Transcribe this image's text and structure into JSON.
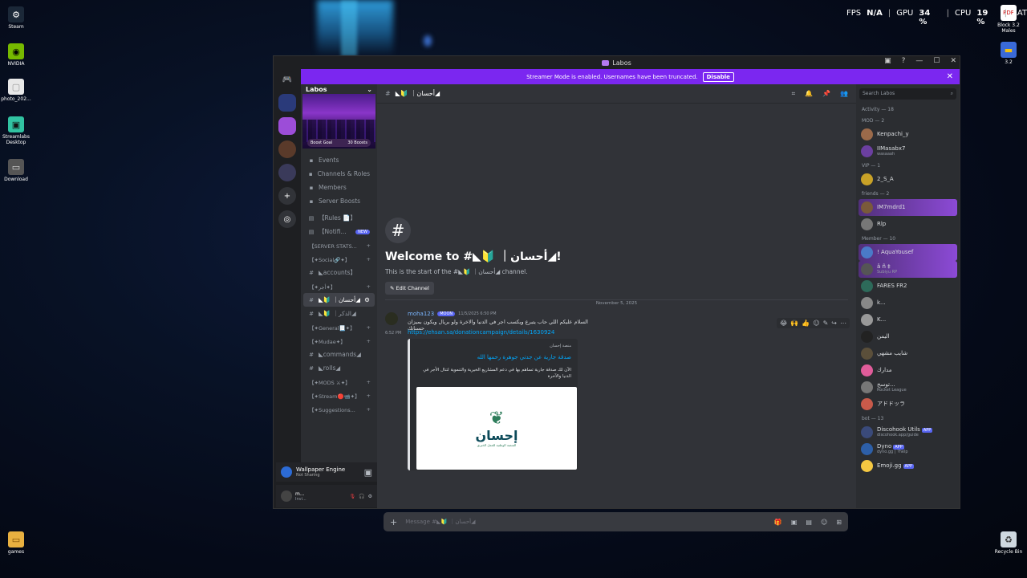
{
  "overlay": {
    "fps_label": "FPS",
    "fps_value": "N/A",
    "gpu_label": "GPU",
    "gpu_value": "34 %",
    "cpu_label": "CPU",
    "cpu_value": "19 %",
    "lat_label": "LAT"
  },
  "desktop": {
    "icons_left": [
      {
        "label": "Steam",
        "icon": "steam-icon",
        "color": "#1b2838"
      },
      {
        "label": "NVIDIA",
        "icon": "nvidia-icon",
        "color": "#76b900"
      },
      {
        "label": "photo_202...",
        "icon": "image-file-icon",
        "color": "#e8e8e8"
      },
      {
        "label": "Streamlabs Desktop",
        "icon": "streamlabs-icon",
        "color": "#31c3a2"
      },
      {
        "label": "Download",
        "icon": "folder-icon",
        "color": "#555"
      },
      {
        "label": "games",
        "icon": "folder-icon",
        "color": "#e8b040"
      }
    ],
    "icons_right": [
      {
        "label": "Block 3.2 Males",
        "icon": "pdf-icon"
      },
      {
        "label": "3.2",
        "icon": "file-icon"
      },
      {
        "label": "Recycle Bin",
        "icon": "recycle-bin-icon"
      }
    ]
  },
  "window": {
    "title": "Labos"
  },
  "banner": {
    "text": "Streamer Mode is enabled. Usernames have been truncated.",
    "button": "Disable"
  },
  "server": {
    "name": "Labos",
    "boost_label": "Boost Goal",
    "boost_count": "30 Boosts",
    "menu": [
      {
        "icon": "calendar-icon",
        "label": "Events"
      },
      {
        "icon": "channels-roles-icon",
        "label": "Channels & Roles"
      },
      {
        "icon": "members-icon",
        "label": "Members"
      },
      {
        "icon": "boost-icon",
        "label": "Server Boosts"
      }
    ],
    "channels": [
      {
        "type": "item",
        "icon": "rules-icon",
        "label": "【Rules 📄】"
      },
      {
        "type": "item",
        "icon": "announce-icon",
        "label": "【Notifi...",
        "badge": "NEW"
      },
      {
        "type": "cat",
        "label": "【SERVER STATS..."
      },
      {
        "type": "cat",
        "label": "【✦Social🔗✦】"
      },
      {
        "type": "item",
        "icon": "hash-icon",
        "label": "◣accounts】"
      },
      {
        "type": "cat",
        "label": "【✦أجر✦】"
      },
      {
        "type": "item",
        "icon": "hash-icon",
        "label": "◣🔰 ｜أحسان◢",
        "active": true
      },
      {
        "type": "item",
        "icon": "hash-icon",
        "label": "◣🔰 ｜الذكر◢"
      },
      {
        "type": "cat",
        "label": "【✦General📃✦】"
      },
      {
        "type": "cat",
        "label": "【✦Mudae✦】"
      },
      {
        "type": "item",
        "icon": "hash-icon",
        "label": "◣commands◢"
      },
      {
        "type": "item",
        "icon": "hash-icon",
        "label": "◣rolls◢"
      },
      {
        "type": "cat",
        "label": "【✦MODS ⚔✦】"
      },
      {
        "type": "cat",
        "label": "【✦Stream🔴📹✦】"
      },
      {
        "type": "cat",
        "label": "【✦Suggestions..."
      }
    ]
  },
  "activity": {
    "title": "Wallpaper Engine",
    "subtitle": "Not Sharing"
  },
  "user": {
    "name": "m...",
    "status": "Invi..."
  },
  "channel": {
    "name": "◣🔰 ｜أحسان◢",
    "welcome_title": "Welcome to #◣🔰 ｜أحسان◢!",
    "welcome_sub": "This is the start of the #◣🔰 ｜أحسان◢ channel.",
    "edit_button": "Edit Channel",
    "date_divider": "November 5, 2025",
    "message_placeholder": "Message #◣🔰 ｜أحسان◢"
  },
  "message": {
    "author": "moha123",
    "badge": "MOON",
    "timestamp": "11/5/2025 6:50 PM",
    "text": "السلام عليكم اللي حاب يتبرع ويكسب اجر في الدنيا والاخرة ولو بريال ويكون بميزان حسناتك",
    "time2": "6:52 PM",
    "link": "https://ehsan.sa/donationcampaign/details/1630924",
    "embed_provider": "منصة إحسان",
    "embed_title": "صدقة جارية عن جدتي جوهرة رحمها الله",
    "embed_desc": "الآن لك صدقة جارية تساهم بها في دعم المشاريع الخيرية والتنموية لتنال الأجر في الدنيا والآخرة",
    "logo_word": "إحسان",
    "logo_sub": "المنصة الوطنية للعمل الخيري"
  },
  "members_panel": {
    "search_placeholder": "Search Labos",
    "sections": [
      {
        "title": "Activity — 18",
        "members": []
      },
      {
        "title": "MOD — 2",
        "members": [
          {
            "name": "Kenpachi_y",
            "sub": "",
            "color": "#9b6a4a"
          },
          {
            "name": "IIMasabx7",
            "sub": "wasaaah",
            "color": "#6b3fa0"
          }
        ]
      },
      {
        "title": "VIP — 1",
        "members": [
          {
            "name": "2_S_A",
            "sub": "",
            "color": "#c9a227"
          }
        ]
      },
      {
        "title": "friends — 2",
        "members": [
          {
            "name": "IM7mdrd1",
            "sub": "",
            "color": "#7a5a3a",
            "hl": true
          },
          {
            "name": "Rlp",
            "sub": "",
            "color": "#777"
          }
        ]
      },
      {
        "title": "Member — 10",
        "members": [
          {
            "name": "! AquaYousef",
            "sub": "",
            "color": "#4a7ac8",
            "hl": true
          },
          {
            "name": "â ñ ‡",
            "sub": "Subiyu RP",
            "color": "#555",
            "hl": true
          },
          {
            "name": "FARES FR2",
            "sub": "",
            "color": "#2d6a5a"
          },
          {
            "name": "k...",
            "sub": "",
            "color": "#888"
          },
          {
            "name": "K...",
            "sub": "",
            "color": "#999"
          },
          {
            "name": "اليمن",
            "sub": "",
            "color": "#222"
          },
          {
            "name": "شايب مشهي",
            "sub": "",
            "color": "#5b4f3a"
          },
          {
            "name": "مدارك",
            "sub": "",
            "color": "#e05c9a"
          },
          {
            "name": "توسخ...",
            "sub": "Rocket League",
            "color": "#777"
          },
          {
            "name": "アドドッラ",
            "sub": "",
            "color": "#c85a4a"
          }
        ]
      },
      {
        "title": "bot — 13",
        "members": [
          {
            "name": "Discohook Utils",
            "sub": "discohook.app/guide",
            "color": "#3a4a7a",
            "app": "APP"
          },
          {
            "name": "Dyno",
            "sub": "dyno.gg | ?help",
            "color": "#2d5fa8",
            "app": "APP"
          },
          {
            "name": "Emoji.gg",
            "sub": "",
            "color": "#f5c842",
            "app": "APP"
          }
        ]
      }
    ]
  }
}
